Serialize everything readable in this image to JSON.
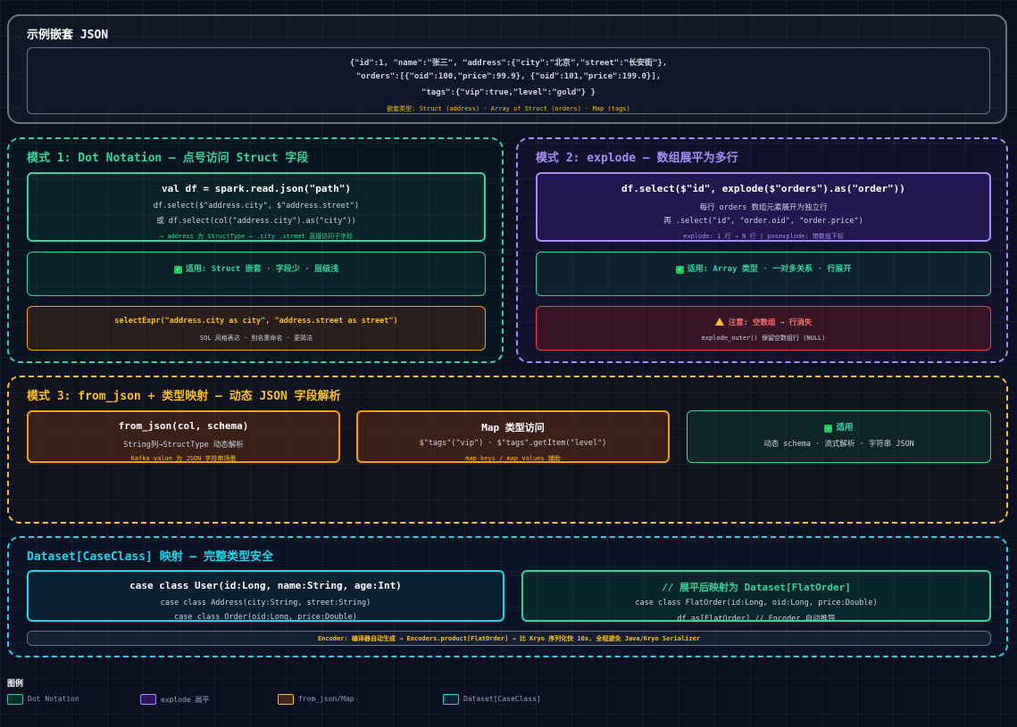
{
  "sample": {
    "title": "示例嵌套 JSON",
    "json_line1": "{\"id\":1, \"name\":\"张三\", \"address\":{\"city\":\"北京\",\"street\":\"长安街\"},",
    "json_line2": "\"orders\":[{\"oid\":100,\"price\":99.9}, {\"oid\":101,\"price\":199.0}],",
    "json_line3": "\"tags\":{\"vip\":true,\"level\":\"gold\"} }",
    "note": "嵌套类型: Struct (address) · Array of Struct (orders) · Map (tags)"
  },
  "mode1": {
    "title": "模式 1: Dot Notation — 点号访问 Struct 字段",
    "box1": {
      "code": "val df = spark.read.json(\"path\")",
      "line1": "df.select($\"address.city\", $\"address.street\")",
      "line2": "或 df.select(col(\"address.city\").as(\"city\"))",
      "note": "→ address 为 StructType → .city .street 直接访问子字段"
    },
    "box2": {
      "text": "适用: Struct 嵌套 · 字段少 · 层级浅"
    },
    "box3": {
      "code": "selectExpr(\"address.city as city\", \"address.street as street\")",
      "sub": "SQL 风格表达 · 别名重命名 · 更简洁"
    }
  },
  "mode2": {
    "title": "模式 2: explode — 数组展平为多行",
    "box1": {
      "code": "df.select($\"id\", explode($\"orders\").as(\"order\"))",
      "line1": "每行 orders 数组元素展开为独立行",
      "line2": "再 .select(\"id\", \"order.oid\", \"order.price\")",
      "note": "explode: 1 行 → N 行 | posexplode: 带数组下标"
    },
    "box2": {
      "text": "适用: Array 类型 · 一对多关系 · 行展开"
    },
    "box3": {
      "warn": "注意: 空数组 → 行消失",
      "sub": "explode_outer() 保留空数组行 (NULL)"
    }
  },
  "mode3": {
    "title": "模式 3: from_json + 类型映射 — 动态 JSON 字段解析",
    "box1": {
      "code": "from_json(col, schema)",
      "sub": "String列→StructType 动态解析",
      "note": "Kafka value 为 JSON 字符串场景"
    },
    "box2": {
      "code": "Map 类型访问",
      "sub": "$\"tags\"(\"vip\") · $\"tags\".getItem(\"level\")",
      "note": "map_keys / map_values 辅助"
    },
    "box3": {
      "title": "适用",
      "sub": "动态 schema · 流式解析 · 字符串 JSON"
    }
  },
  "mode4": {
    "title": "Dataset[CaseClass] 映射 — 完整类型安全",
    "box1": {
      "code": "case class User(id:Long, name:String, age:Int)",
      "line1": "case class Address(city:String, street:String)",
      "line2": "case class Order(oid:Long, price:Double)"
    },
    "box2": {
      "code": "// 展平后映射为 Dataset[FlatOrder]",
      "line1": "case class FlatOrder(id:Long, oid:Long, price:Double)",
      "line2": "df.as[FlatOrder] // Encoder 自动推导"
    },
    "footer": "Encoder: 编译器自动生成 → Encoders.product[FlatOrder] → 比 Kryo 序列化快 10x, 全程避免 Java/Kryo Serializer"
  },
  "legend": {
    "title": "图例",
    "items": [
      {
        "label": "Dot Notation",
        "color": "#34d399"
      },
      {
        "label": "explode 展平",
        "color": "#a78bfa"
      },
      {
        "label": "from_json/Map",
        "color": "#fbbf24"
      },
      {
        "label": "Dataset[CaseClass]",
        "color": "#22d3ee"
      }
    ]
  },
  "colors": {
    "green": "#34d399",
    "purple": "#a78bfa",
    "amber": "#fbbf24",
    "cyan": "#22d3ee",
    "red": "#ef4444",
    "slate": "#64748b"
  }
}
